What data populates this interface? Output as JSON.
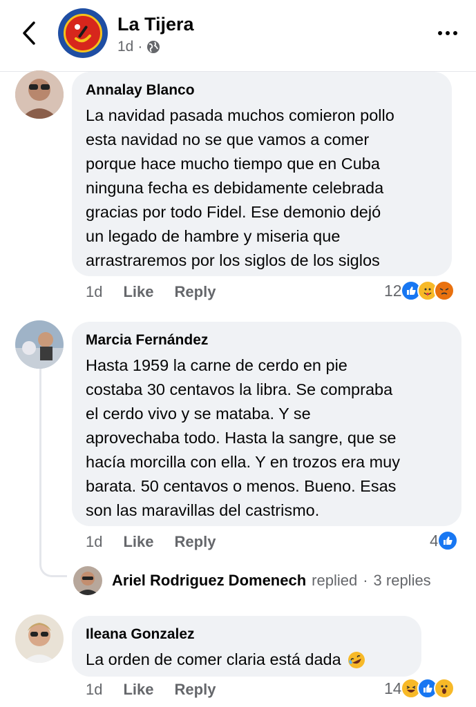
{
  "header": {
    "page_name": "La Tijera",
    "time": "1d",
    "separator": "·",
    "icons": {
      "back": "chevron-left-icon",
      "privacy": "globe-icon",
      "more": "more-horizontal-icon"
    }
  },
  "comments": [
    {
      "author": "Annalay Blanco",
      "text": "La navidad pasada muchos comieron pollo\nesta navidad no se que vamos a comer\nporque hace mucho tiempo que en Cuba\nninguna fecha es debidamente celebrada\ngracias por todo Fidel. Ese demonio dejó\nun legado de hambre y miseria que\narrastraremos por los siglos de los siglos",
      "time": "1d",
      "like_label": "Like",
      "reply_label": "Reply",
      "reaction_count": "12",
      "reactions": [
        "like",
        "care",
        "angry"
      ]
    },
    {
      "author": "Marcia Fernández",
      "text": "Hasta 1959 la carne de cerdo en pie\ncostaba 30 centavos la libra. Se compraba\nel cerdo vivo y se mataba. Y se\naprovechaba todo. Hasta la sangre,  que se\nhacía morcilla con ella. Y en trozos era muy\nbarata. 50 centavos o menos. Bueno.   Esas\nson las maravillas del castrismo.",
      "time": "1d",
      "like_label": "Like",
      "reply_label": "Reply",
      "reaction_count": "4",
      "reactions": [
        "like"
      ],
      "replies": {
        "name": "Ariel Rodriguez Domenech",
        "verb": "replied",
        "separator": "·",
        "count_label": "3 replies"
      }
    },
    {
      "author": "Ileana Gonzalez",
      "text": "La orden de comer claria está dada",
      "emoji": "rofl-emoji",
      "time": "1d",
      "like_label": "Like",
      "reply_label": "Reply",
      "reaction_count": "14",
      "reactions": [
        "haha",
        "like",
        "wow"
      ]
    }
  ],
  "colors": {
    "bubble": "#f0f2f5",
    "secondary_text": "#65676b",
    "like_blue": "#1877f2",
    "emoji_yellow": "#f7b928",
    "angry_orange": "#e9710f"
  }
}
